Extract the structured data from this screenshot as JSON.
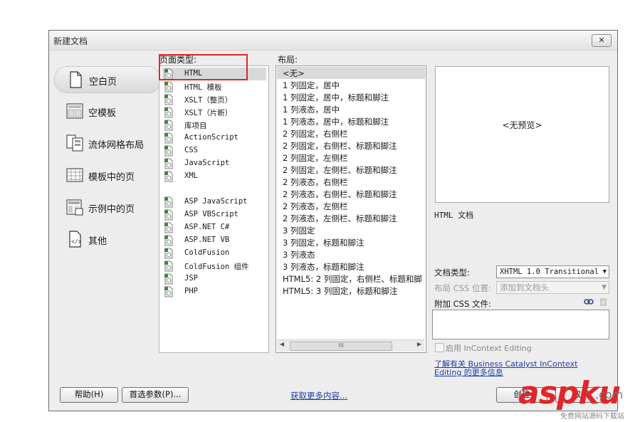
{
  "window": {
    "title": "新建文档",
    "close_label": "☒"
  },
  "categories": [
    {
      "label": "空白页",
      "icon": "blank-page-icon",
      "selected": true
    },
    {
      "label": "空模板",
      "icon": "blank-template-icon",
      "selected": false
    },
    {
      "label": "流体网格布局",
      "icon": "fluid-grid-icon",
      "selected": false
    },
    {
      "label": "模板中的页",
      "icon": "template-page-icon",
      "selected": false
    },
    {
      "label": "示例中的页",
      "icon": "sample-page-icon",
      "selected": false
    },
    {
      "label": "其他",
      "icon": "code-file-icon",
      "selected": false
    }
  ],
  "page_type": {
    "label": "页面类型:",
    "items": [
      "HTML",
      "HTML 模板",
      "XSLT（整页）",
      "XSLT（片断）",
      "库项目",
      "ActionScript",
      "CSS",
      "JavaScript",
      "XML",
      "ASP JavaScript",
      "ASP VBScript",
      "ASP.NET C#",
      "ASP.NET VB",
      "ColdFusion",
      "ColdFusion 组件",
      "JSP",
      "PHP"
    ],
    "selected": "HTML"
  },
  "layout": {
    "label": "布局:",
    "items": [
      "<无>",
      "1 列固定，居中",
      "1 列固定，居中，标题和脚注",
      "1 列液态，居中",
      "1 列液态，居中，标题和脚注",
      "2 列固定，右侧栏",
      "2 列固定，右侧栏、标题和脚注",
      "2 列固定，左侧栏",
      "2 列固定，左侧栏、标题和脚注",
      "2 列液态，右侧栏",
      "2 列液态，右侧栏、标题和脚注",
      "2 列液态，左侧栏",
      "2 列液态，左侧栏、标题和脚注",
      "3 列固定",
      "3 列固定，标题和脚注",
      "3 列液态",
      "3 列液态，标题和脚注",
      "HTML5: 2 列固定，右侧栏、标题和脚",
      "HTML5: 3 列固定，标题和脚注"
    ],
    "selected": "<无>",
    "scroll_thumb": "III"
  },
  "preview": {
    "no_preview": "<无预览>",
    "description": "HTML 文档",
    "doctype_label": "文档类型:",
    "doctype_value": "XHTML 1.0 Transitional",
    "css_position_label": "布局 CSS 位置:",
    "css_position_value": "添加到文档头",
    "attach_css_label": "附加 CSS 文件:",
    "incontext_label": "启用 InContext Editing",
    "incontext_link": "了解有关 Business Catalyst InContext",
    "incontext_link2": "Editing 的更多信息"
  },
  "footer": {
    "help": "帮助(H)",
    "preferences": "首选参数(P)...",
    "more_content": "获取更多内容...",
    "create": "创建",
    "cancel": "取消"
  },
  "watermark": {
    "brand": "aspku",
    "domain": ".com",
    "tagline": "免费网站源码下载站"
  },
  "colors": {
    "highlight_box": "#e0262b",
    "link": "#1a3ea8"
  }
}
